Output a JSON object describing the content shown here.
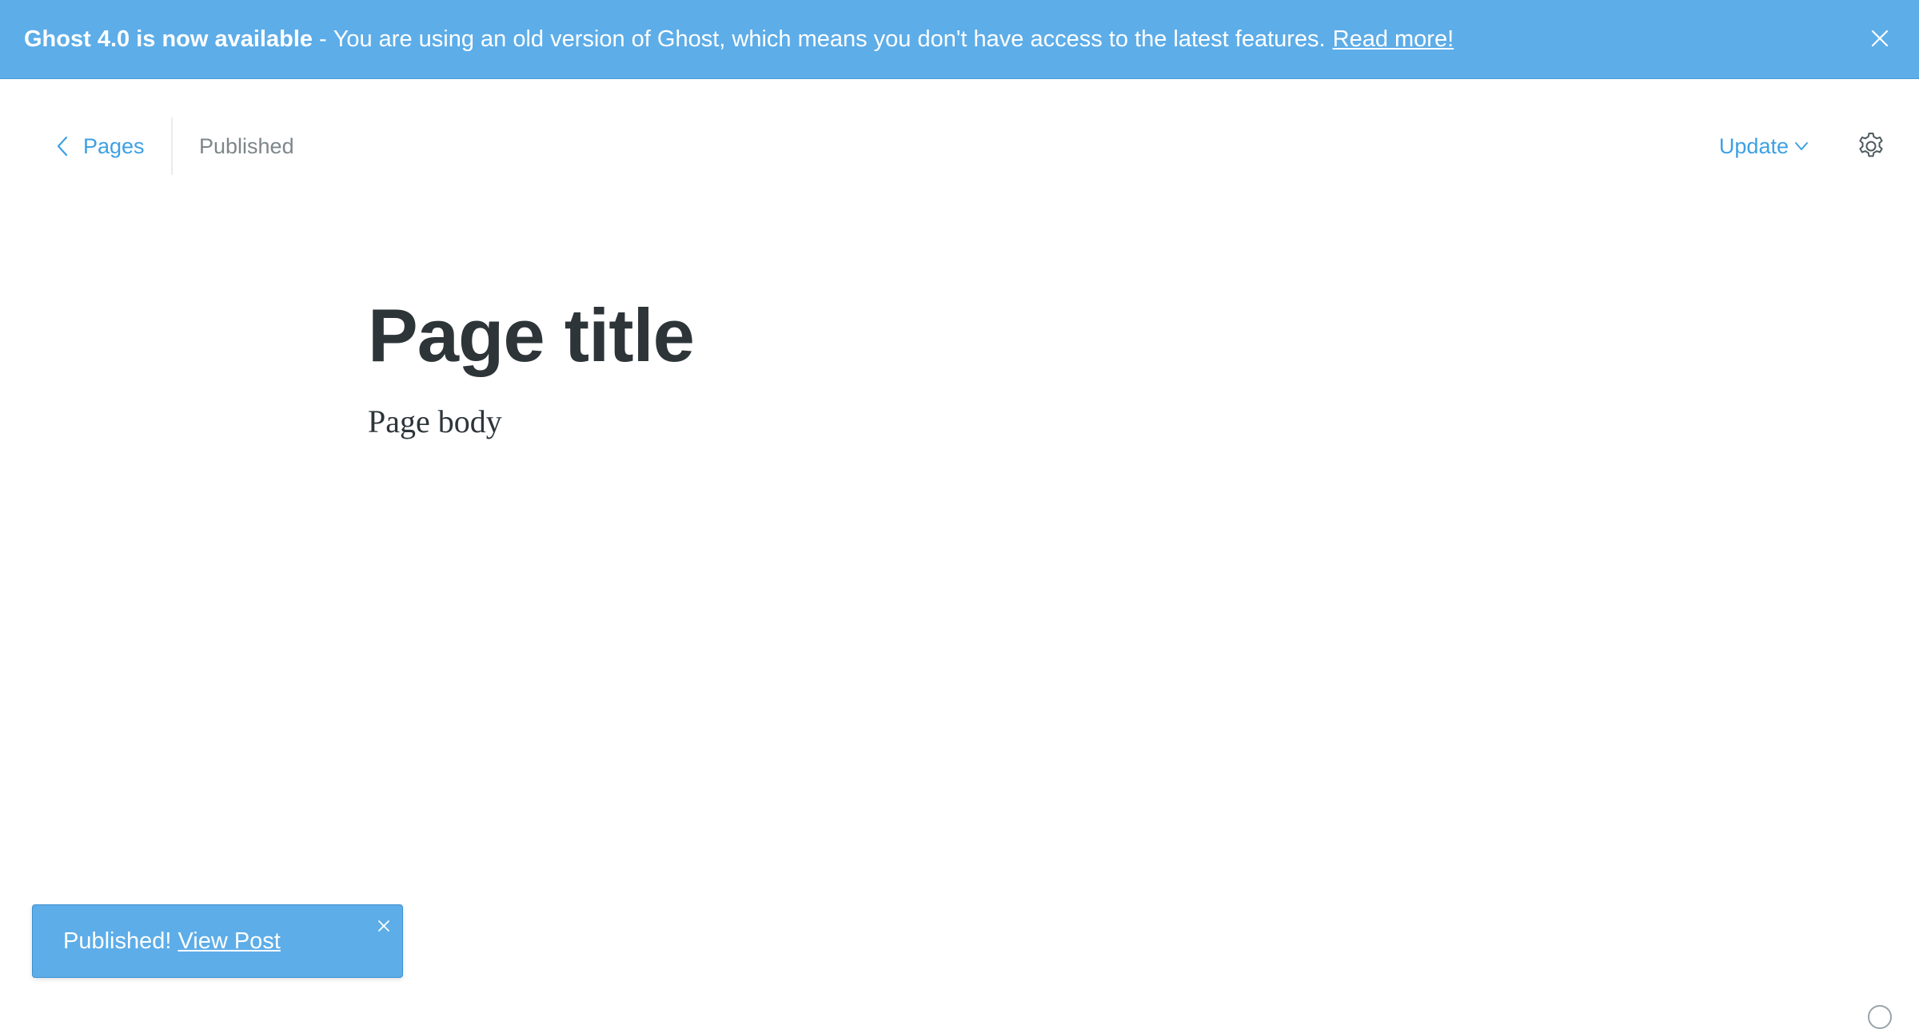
{
  "banner": {
    "strong_text": "Ghost 4.0 is now available",
    "separator": "-",
    "message": "You are using an old version of Ghost, which means you don't have access to the latest features.",
    "link_text": "Read more!",
    "close_icon": "close-icon",
    "background_color": "#5dade8"
  },
  "header": {
    "back_label": "Pages",
    "back_icon": "chevron-left-icon",
    "status": "Published",
    "update_label": "Update",
    "update_icon": "chevron-down-icon",
    "settings_icon": "gear-icon",
    "accent_color": "#3ea0e4"
  },
  "editor": {
    "title": "Page title",
    "body": "Page body"
  },
  "toast": {
    "message": "Published!",
    "link_text": "View Post",
    "close_icon": "close-icon",
    "background_color": "#5dade8"
  },
  "footer": {
    "corner_icon": "help-icon"
  }
}
